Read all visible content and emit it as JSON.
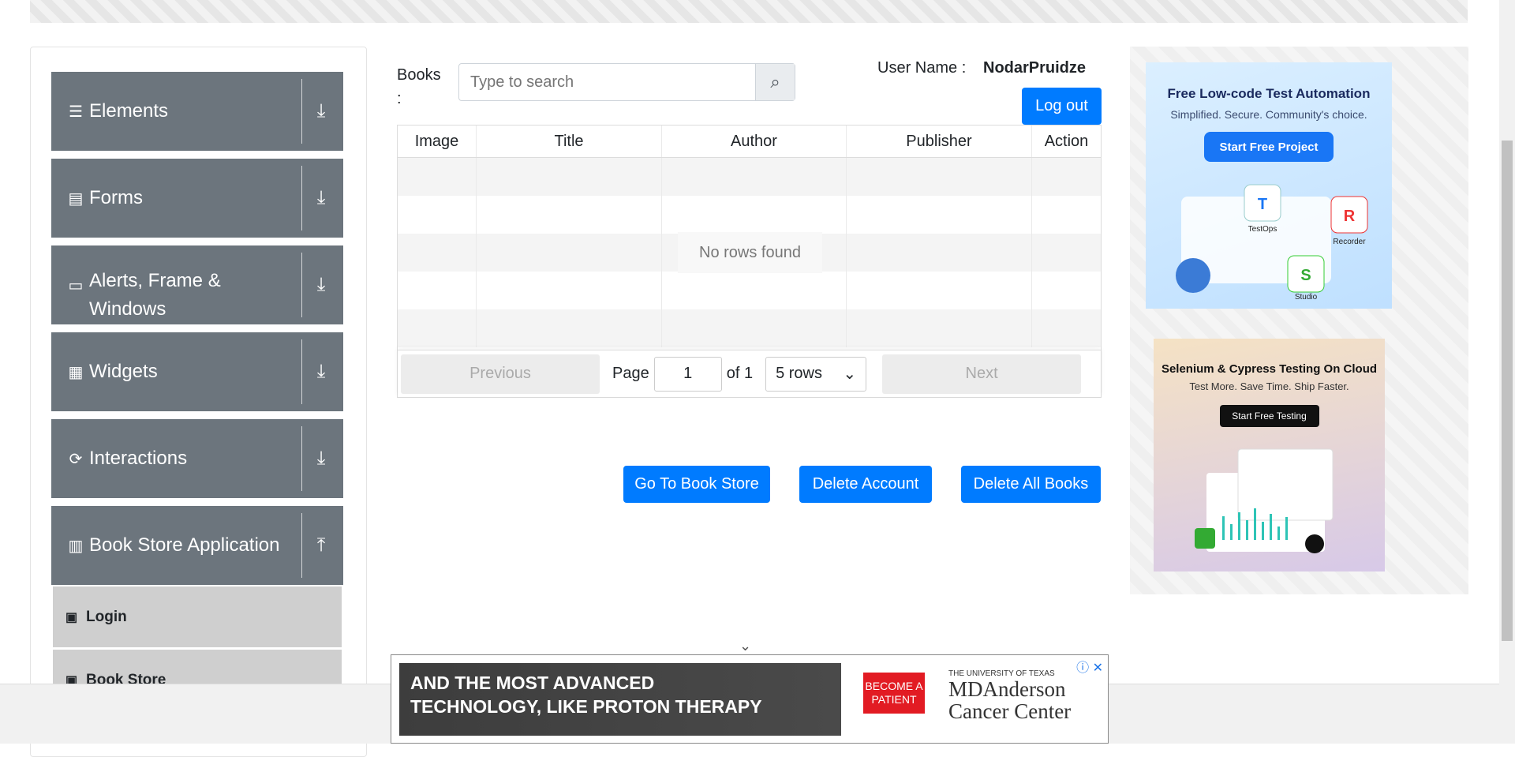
{
  "sidebar": {
    "groups": [
      {
        "label": "Elements",
        "icon": "hamburger-icon",
        "glyph": "☰",
        "arrow": "⤓"
      },
      {
        "label": "Forms",
        "icon": "document-icon",
        "glyph": "▤",
        "arrow": "⤓"
      },
      {
        "label": "Alerts, Frame & Windows",
        "icon": "window-icon",
        "glyph": "▭",
        "arrow": "⤓"
      },
      {
        "label": "Widgets",
        "icon": "widgets-icon",
        "glyph": "▦",
        "arrow": "⤓"
      },
      {
        "label": "Interactions",
        "icon": "interactions-icon",
        "glyph": "⟳",
        "arrow": "⤓"
      },
      {
        "label": "Book Store Application",
        "icon": "books-icon",
        "glyph": "▥",
        "arrow": "⤒"
      }
    ],
    "subitems": [
      {
        "label": "Login",
        "glyph": "▣"
      },
      {
        "label": "Book Store",
        "glyph": "▣"
      }
    ]
  },
  "main": {
    "books_label": "Books :",
    "search_placeholder": "Type to search",
    "search_glyph": "⌕",
    "user_label": "User Name :",
    "user_value": "NodarPruidze",
    "logout": "Log out",
    "columns": [
      "Image",
      "Title",
      "Author",
      "Publisher",
      "Action"
    ],
    "no_rows": "No rows found",
    "pager": {
      "previous": "Previous",
      "page_label": "Page",
      "page_value": "1",
      "of_label": "of 1",
      "rows_value": "5 rows",
      "next": "Next"
    },
    "buttons": {
      "store": "Go To Book Store",
      "delete_account": "Delete Account",
      "delete_books": "Delete All Books"
    }
  },
  "ads": {
    "ad1_title": "Free Low-code Test Automation",
    "ad1_sub": "Simplified. Secure. Community's choice.",
    "ad1_cta": "Start Free Project",
    "ad1_labels": [
      "TestOps",
      "Recorder",
      "Studio"
    ],
    "ad2_title": "Selenium & Cypress Testing On Cloud",
    "ad2_sub": "Test More. Save Time. Ship Faster.",
    "ad2_cta": "Start Free Testing",
    "bottom_headline_1": "AND THE MOST ADVANCED",
    "bottom_headline_2": "TECHNOLOGY, LIKE PROTON THERAPY",
    "bottom_cta": "BECOME A PATIENT",
    "bottom_org_small": "THE UNIVERSITY OF TEXAS",
    "bottom_org_1": "MDAnderson",
    "bottom_org_2": "Cancer Center"
  }
}
